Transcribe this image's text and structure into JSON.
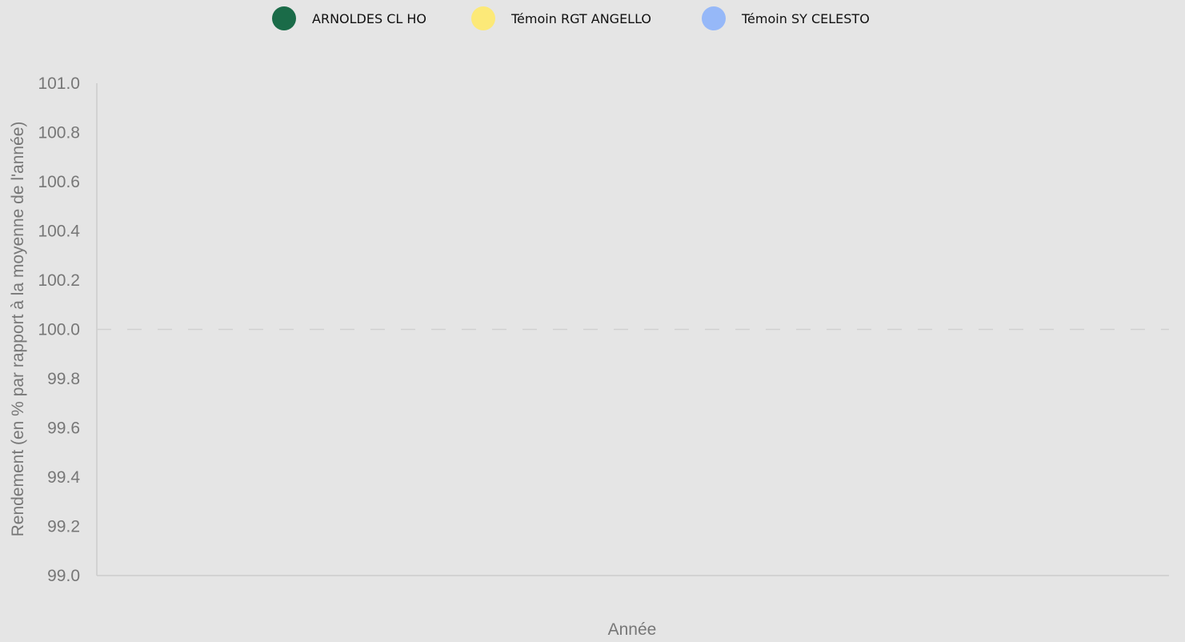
{
  "legend": [
    {
      "label": "ARNOLDES CL HO",
      "color": "#1a6b48"
    },
    {
      "label": "Témoin RGT ANGELLO",
      "color": "#fce978"
    },
    {
      "label": "Témoin SY CELESTO",
      "color": "#96b8f8"
    }
  ],
  "chart_data": {
    "type": "line",
    "xlabel": "Année",
    "ylabel": "Rendement (en % par rapport à la moyenne de l'année)",
    "ylim": [
      99.0,
      101.0
    ],
    "yticks": [
      "101.0",
      "100.8",
      "100.6",
      "100.4",
      "100.2",
      "100.0",
      "99.8",
      "99.6",
      "99.4",
      "99.2",
      "99.0"
    ],
    "reference_line": 100.0,
    "grid": false,
    "legend_position": "top",
    "series": [
      {
        "name": "ARNOLDES CL HO",
        "color": "#1a6b48",
        "x": [],
        "y": []
      },
      {
        "name": "Témoin RGT ANGELLO",
        "color": "#fce978",
        "x": [],
        "y": []
      },
      {
        "name": "Témoin SY CELESTO",
        "color": "#96b8f8",
        "x": [],
        "y": []
      }
    ]
  }
}
